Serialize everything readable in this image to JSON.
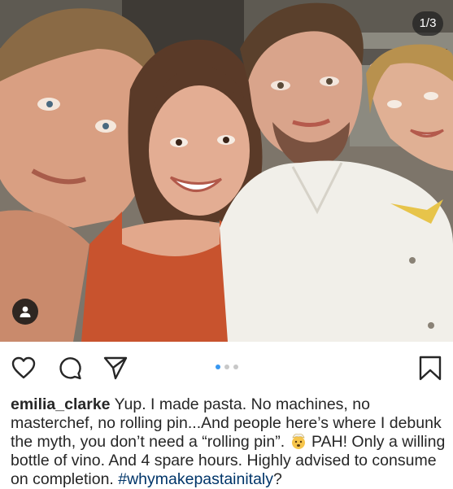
{
  "post": {
    "image_counter": "1/3",
    "image_alt": "Selfie of four smiling friends",
    "carousel": {
      "total": 3,
      "active_index": 0
    }
  },
  "actions": {
    "like_icon": "heart-icon",
    "comment_icon": "comment-icon",
    "share_icon": "share-icon",
    "save_icon": "bookmark-icon",
    "tag_icon": "user-tag-icon"
  },
  "caption": {
    "username": "emilia_clarke",
    "text_1": " Yup. I made pasta. No machines, no masterchef, no rolling pin...And people here’s where I debunk the myth, you don’t need a “rolling pin”. ",
    "emoji": "exploding-head-emoji",
    "text_2": " PAH! Only a willing bottle of vino. And 4 spare hours. Highly advised to consume on completion. ",
    "hashtag": "#whymakepastainitaly",
    "text_3": "?"
  },
  "colors": {
    "link_blue": "#003569",
    "active_dot": "#3897f0",
    "text": "#262626"
  }
}
